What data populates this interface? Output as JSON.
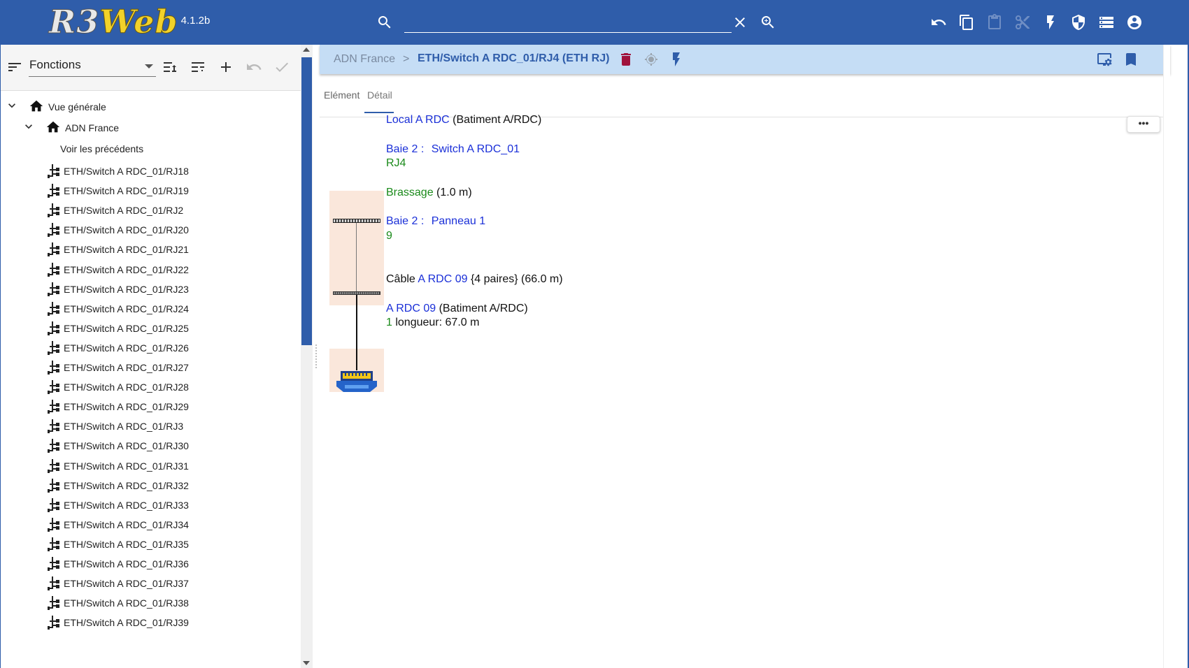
{
  "app": {
    "logo_r3": "R3",
    "logo_web": "Web",
    "version": "4.1.2b",
    "colors": {
      "bar": "#2f5daa",
      "link": "#1a2fd8",
      "green": "#1a8a1a",
      "breadcrumb_bg": "#c5ddf5",
      "trash": "#a0123c"
    }
  },
  "topbar": {
    "search_value": "",
    "icons": [
      "search-icon",
      "clear-icon",
      "zoom-in-icon",
      "undo-icon",
      "copy-icon",
      "paste-icon",
      "cut-icon",
      "bolt-icon",
      "shield-icon",
      "storage-icon",
      "account-icon"
    ]
  },
  "left": {
    "function_select": "Fonctions",
    "tree": {
      "root": "Vue générale",
      "child": "ADN France",
      "show_previous": "Voir les précédents",
      "ports": [
        "ETH/Switch A RDC_01/RJ18",
        "ETH/Switch A RDC_01/RJ19",
        "ETH/Switch A RDC_01/RJ2",
        "ETH/Switch A RDC_01/RJ20",
        "ETH/Switch A RDC_01/RJ21",
        "ETH/Switch A RDC_01/RJ22",
        "ETH/Switch A RDC_01/RJ23",
        "ETH/Switch A RDC_01/RJ24",
        "ETH/Switch A RDC_01/RJ25",
        "ETH/Switch A RDC_01/RJ26",
        "ETH/Switch A RDC_01/RJ27",
        "ETH/Switch A RDC_01/RJ28",
        "ETH/Switch A RDC_01/RJ29",
        "ETH/Switch A RDC_01/RJ3",
        "ETH/Switch A RDC_01/RJ30",
        "ETH/Switch A RDC_01/RJ31",
        "ETH/Switch A RDC_01/RJ32",
        "ETH/Switch A RDC_01/RJ33",
        "ETH/Switch A RDC_01/RJ34",
        "ETH/Switch A RDC_01/RJ35",
        "ETH/Switch A RDC_01/RJ36",
        "ETH/Switch A RDC_01/RJ37",
        "ETH/Switch A RDC_01/RJ38",
        "ETH/Switch A RDC_01/RJ39"
      ]
    }
  },
  "main": {
    "breadcrumb": {
      "root": "ADN France",
      "separator": ">",
      "current": "ETH/Switch A RDC_01/RJ4 (ETH RJ)"
    },
    "tabs": [
      "Elément",
      "Détail"
    ],
    "active_tab": "Détail",
    "more_label": "•••",
    "detail": {
      "local_link": "Local A RDC",
      "local_rest": " (Batiment A/RDC)",
      "baie1_prefix": "Baie 2 : ",
      "baie1_link": "Switch A RDC_01",
      "port1": "RJ4",
      "brassage_link": "Brassage",
      "brassage_rest": " (1.0 m)",
      "baie2_prefix": "Baie 2 : ",
      "baie2_link": "Panneau 1",
      "port2": "9",
      "cable_prefix": "Câble ",
      "cable_link": "A RDC 09",
      "cable_rest": " {4 paires} (66.0 m)",
      "outlet_link": "A RDC 09",
      "outlet_rest": " (Batiment A/RDC)",
      "outlet_num": "1",
      "outlet_len": " longueur: 67.0 m"
    }
  }
}
